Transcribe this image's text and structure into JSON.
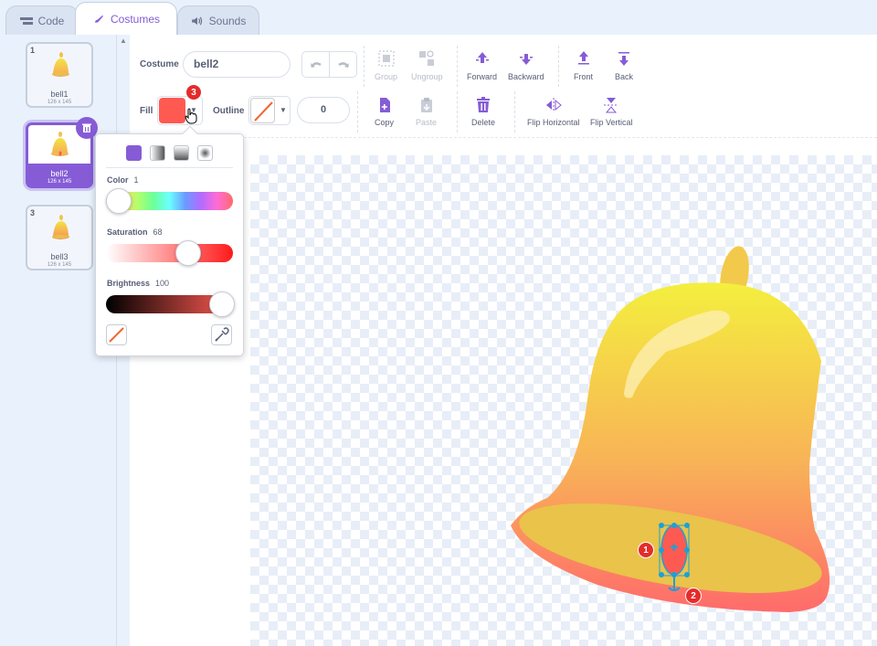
{
  "tabs": [
    {
      "label": "Code",
      "icon": "code-icon"
    },
    {
      "label": "Costumes",
      "icon": "brush-icon"
    },
    {
      "label": "Sounds",
      "icon": "speaker-icon"
    }
  ],
  "costumes": [
    {
      "num": "1",
      "name": "bell1",
      "size": "126 x 145"
    },
    {
      "num": "2",
      "name": "bell2",
      "size": "126 x 145"
    },
    {
      "num": "3",
      "name": "bell3",
      "size": "126 x 145"
    }
  ],
  "toolbar": {
    "costume_label": "Costume",
    "costume_name": "bell2",
    "group": "Group",
    "ungroup": "Ungroup",
    "forward": "Forward",
    "backward": "Backward",
    "front": "Front",
    "back": "Back",
    "fill_label": "Fill",
    "outline_label": "Outline",
    "outline_width": "0",
    "copy": "Copy",
    "paste": "Paste",
    "delete": "Delete",
    "flip_horizontal": "Flip Horizontal",
    "flip_vertical": "Flip Vertical",
    "fill_color": "#ff5a52"
  },
  "color_picker": {
    "color_label": "Color",
    "color_value": "1",
    "saturation_label": "Saturation",
    "saturation_value": "68",
    "brightness_label": "Brightness",
    "brightness_value": "100"
  },
  "badges": [
    "1",
    "2",
    "3"
  ],
  "colors": {
    "accent": "#855cd6",
    "badge": "#e52b2b"
  }
}
